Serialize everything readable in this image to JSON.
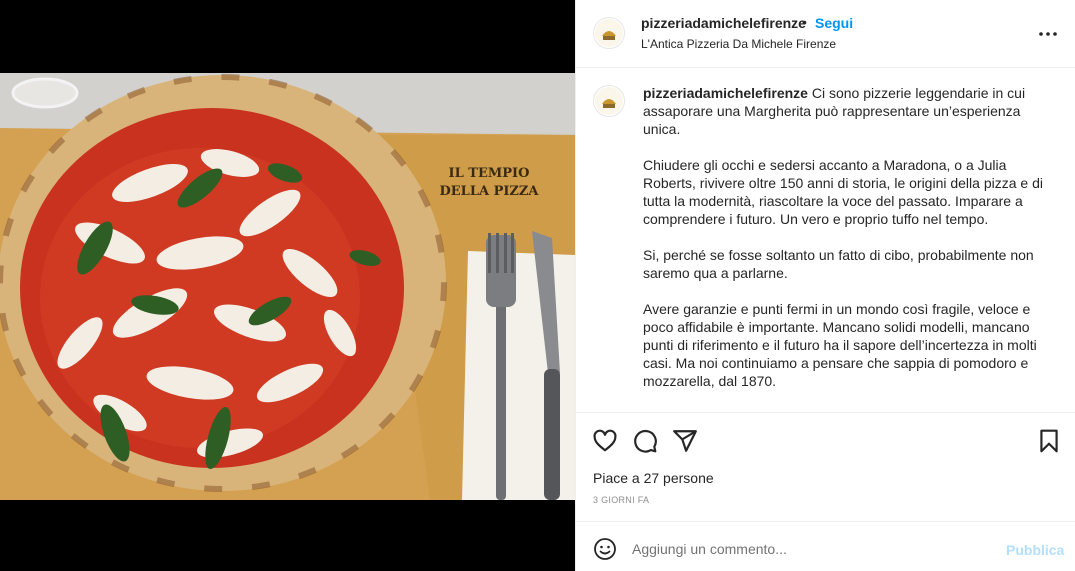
{
  "post": {
    "username": "pizzeriadamichelefirenze",
    "separator": "•",
    "follow_label": "Segui",
    "subtitle": "L'Antica Pizzeria Da Michele Firenze",
    "more_icon": "more-horizontal-icon"
  },
  "photo": {
    "sign_line1": "IL TEMPIO",
    "sign_line2": "DELLA PIZZA"
  },
  "caption": {
    "username": "pizzeriadamichelefirenze",
    "paragraphs": [
      "Ci sono pizzerie leggendarie in cui assaporare una Margherita può rappresentare un’esperienza unica.",
      "Chiudere gli occhi e sedersi accanto a Maradona, o a Julia Roberts, rivivere oltre 150 anni di storia, le origini della pizza e di tutta la modernità, riascoltare la voce del passato. Imparare a comprendere i futuro. Un vero e proprio tuffo nel tempo.",
      "Si, perché se fosse soltanto un fatto di cibo, probabilmente non saremo qua a parlarne.",
      "Avere garanzie e punti fermi in un mondo così fragile, veloce e poco affidabile è importante. Mancano solidi modelli, mancano punti di riferimento e il futuro ha il sapore dell’incertezza in molti casi. Ma noi continuiamo a pensare che sappia di pomodoro e mozzarella, dal 1870."
    ]
  },
  "actions": {
    "icons": [
      "heart-icon",
      "comment-icon",
      "share-icon",
      "bookmark-icon"
    ],
    "likes_text": "Piace a 27 persone",
    "time_text": "3 GIORNI FA"
  },
  "comment": {
    "placeholder": "Aggiungi un commento...",
    "publish_label": "Pubblica"
  },
  "colors": {
    "accent": "#0095f6",
    "publish_disabled": "#b2dffc",
    "text": "#262626",
    "muted": "#8e8e8e"
  }
}
